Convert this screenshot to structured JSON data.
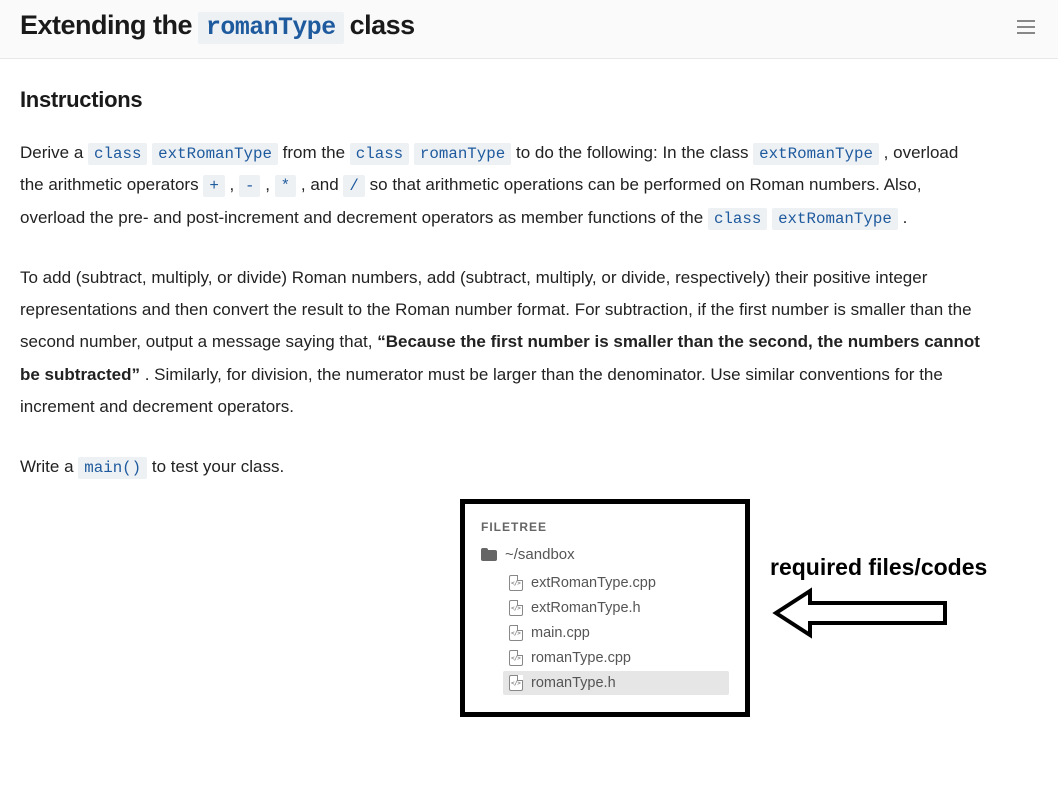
{
  "header": {
    "title_prefix": "Extending the",
    "title_code": "romanType",
    "title_suffix": "class"
  },
  "instructions_heading": "Instructions",
  "para1": {
    "t1": "Derive a ",
    "c1": "class",
    "c2": "extRomanType",
    "t2": " from the ",
    "c3": "class",
    "c4": "romanType",
    "t3": " to do the following: In the class ",
    "c5": "extRomanType",
    "t4": ", overload the arithmetic operators ",
    "op_plus": "+",
    "sep1": ", ",
    "op_minus": "-",
    "sep2": ", ",
    "op_star": "*",
    "sep3": ", and ",
    "op_slash": "/",
    "t5": " so that arithmetic operations can be performed on Roman numbers. Also, overload the pre- and post-increment and decrement operators as member functions of the ",
    "c6": "class",
    "c7": "extRomanType",
    "t6": "."
  },
  "para2": {
    "t1": "To add (subtract, multiply, or divide) Roman numbers, add (subtract, multiply, or divide, respectively) their positive integer representations and then convert the result to the Roman number format. For subtraction, if the first number is smaller than the second number, output a message saying that, ",
    "bold": "“Because the first number is smaller than the second, the numbers cannot be subtracted”",
    "t2": ". Similarly, for division, the numerator must be larger than the denominator. Use similar conventions for the increment and decrement operators."
  },
  "para3": {
    "t1": "Write a ",
    "c1": "main()",
    "t2": " to test your class."
  },
  "filetree": {
    "title": "FILETREE",
    "folder": "~/sandbox",
    "files": {
      "f0": "extRomanType.cpp",
      "f1": "extRomanType.h",
      "f2": "main.cpp",
      "f3": "romanType.cpp",
      "f4": "romanType.h"
    }
  },
  "annotation_label": "required files/codes"
}
